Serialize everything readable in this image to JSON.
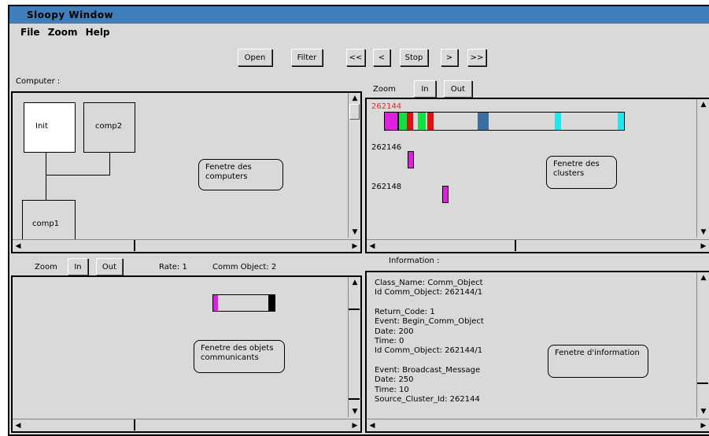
{
  "window": {
    "title": "Sloopy Window"
  },
  "menu": {
    "items": [
      "File",
      "Zoom",
      "Help"
    ]
  },
  "toolbar": {
    "open": "Open",
    "filter": "Filter",
    "rewind": "<<",
    "back": "<",
    "stop": "Stop",
    "forward": ">",
    "fast_forward": ">>"
  },
  "computers": {
    "label": "Computer :",
    "nodes": {
      "init": "Init",
      "comp2": "comp2",
      "comp1": "comp1"
    },
    "callout": "Fenetre des computers"
  },
  "clusters": {
    "zoom_label": "Zoom",
    "zoom_in": "In",
    "zoom_out": "Out",
    "rows": [
      {
        "id": "262144"
      },
      {
        "id": "262146"
      },
      {
        "id": "262148"
      }
    ],
    "callout": "Fenetre des clusters",
    "colors": {
      "highlight_id": "#ff2020",
      "magenta": "#e020e0",
      "green": "#10e040",
      "red": "#e01010",
      "blue": "#3d6ea0",
      "cyan": "#20e8f0"
    }
  },
  "objects": {
    "zoom_label": "Zoom",
    "zoom_in": "In",
    "zoom_out": "Out",
    "rate": "Rate: 1",
    "comm_object": "Comm Object: 2",
    "callout": "Fenetre des objets communicants"
  },
  "information": {
    "label": "Information :",
    "lines": [
      "Class_Name: Comm_Object",
      "Id Comm_Object: 262144/1",
      "",
      "Return_Code: 1",
      "Event: Begin_Comm_Object",
      "Date: 200",
      "Time: 0",
      "Id Comm_Object: 262144/1",
      "",
      "Event: Broadcast_Message",
      "Date: 250",
      "Time: 10",
      "Source_Cluster_Id: 262144"
    ],
    "callout": "Fenetre d'information"
  }
}
